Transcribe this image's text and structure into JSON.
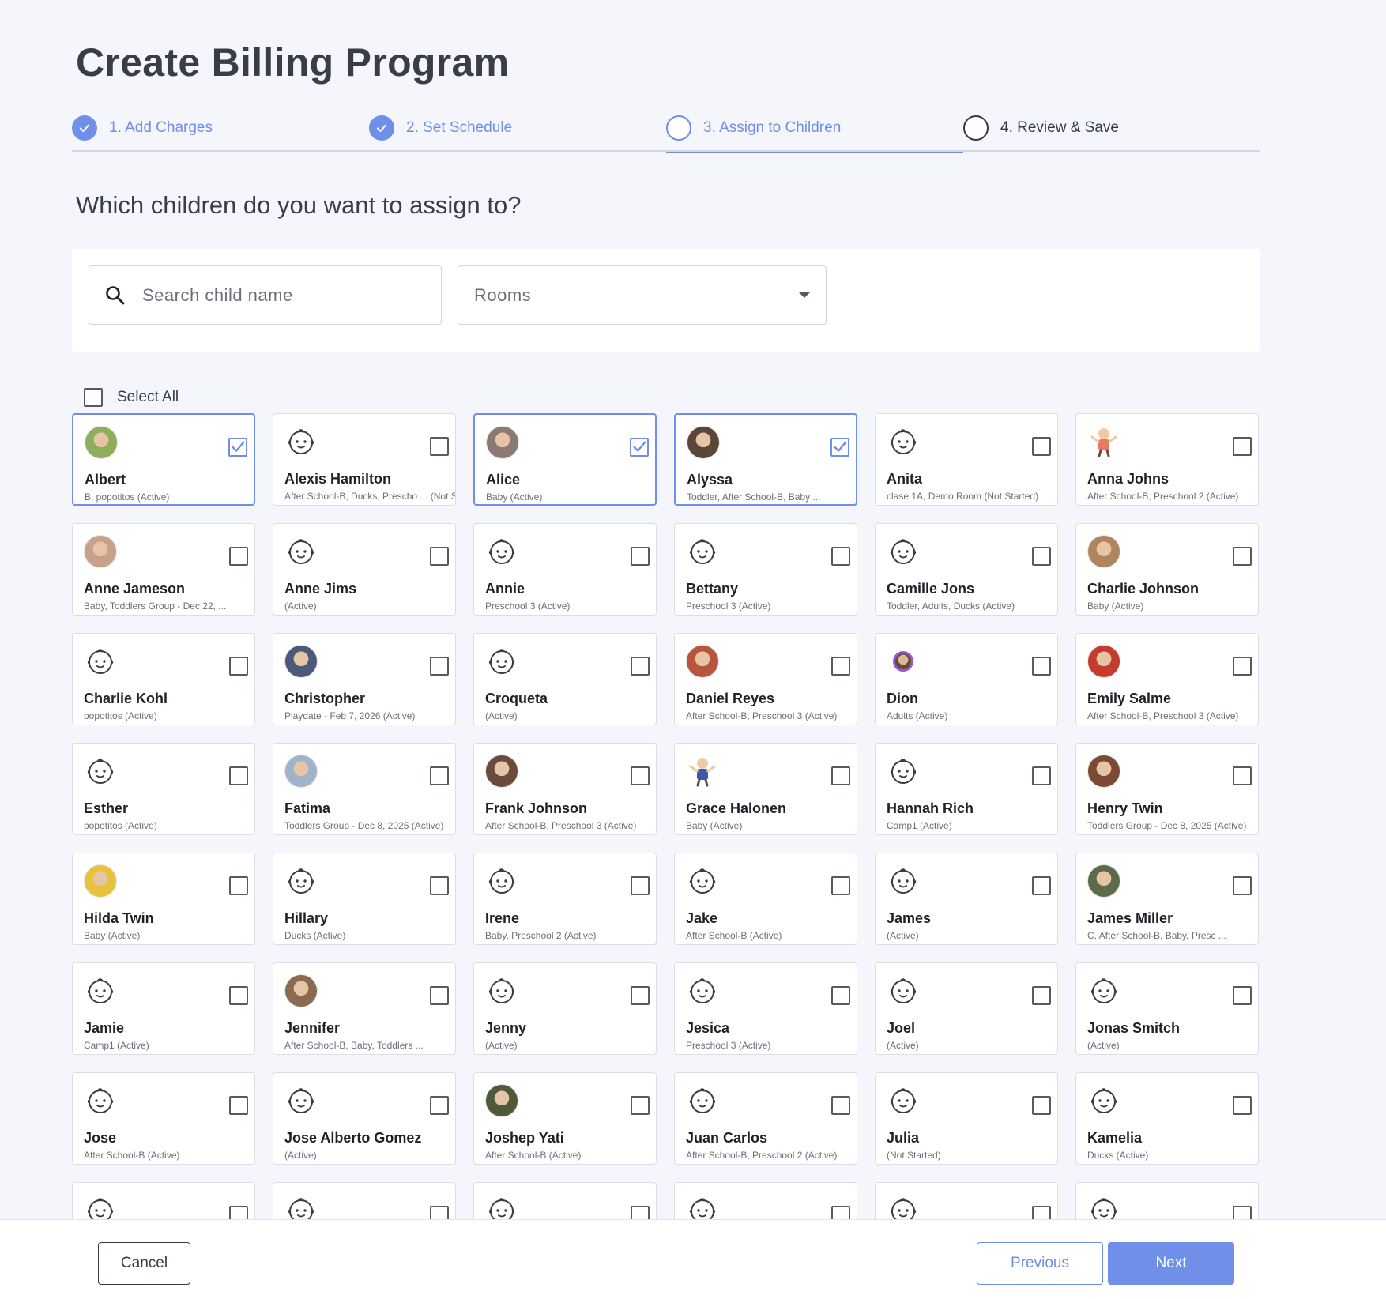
{
  "page": {
    "title": "Create Billing Program",
    "question": "Which children do you want to assign to?"
  },
  "steps": [
    {
      "label": "1. Add Charges",
      "state": "done"
    },
    {
      "label": "2. Set Schedule",
      "state": "done"
    },
    {
      "label": "3. Assign to Children",
      "state": "current"
    },
    {
      "label": "4. Review & Save",
      "state": "todo"
    }
  ],
  "filters": {
    "search_placeholder": "Search child name",
    "rooms_label": "Rooms"
  },
  "select_all": {
    "label": "Select All",
    "checked": false
  },
  "children": [
    {
      "name": "Albert",
      "sub": "B, popotitos (Active)",
      "avatar": "photo",
      "color": "#8fae5a",
      "checked": true
    },
    {
      "name": "Alexis Hamilton",
      "sub": "After School-B, Ducks, Prescho ... (Not Started)",
      "avatar": "baby-icon",
      "checked": false
    },
    {
      "name": "Alice",
      "sub": "Baby (Active)",
      "avatar": "photo",
      "color": "#8a7a72",
      "checked": true
    },
    {
      "name": "Alyssa",
      "sub": "Toddler, After School-B, Baby ...",
      "avatar": "photo",
      "color": "#5b4638",
      "checked": true
    },
    {
      "name": "Anita",
      "sub": "clase 1A, Demo Room (Not Started)",
      "avatar": "baby-icon",
      "checked": false
    },
    {
      "name": "Anna Johns",
      "sub": "After School-B, Preschool 2 (Active)",
      "avatar": "cartoon",
      "color": "#e87a5d",
      "checked": false
    },
    {
      "name": "Anne Jameson",
      "sub": "Baby, Toddlers Group - Dec 22, ...",
      "avatar": "photo",
      "color": "#c9a089",
      "checked": false
    },
    {
      "name": "Anne Jims",
      "sub": "(Active)",
      "avatar": "baby-icon",
      "checked": false
    },
    {
      "name": "Annie",
      "sub": "Preschool 3 (Active)",
      "avatar": "baby-icon",
      "checked": false
    },
    {
      "name": "Bettany",
      "sub": "Preschool 3 (Active)",
      "avatar": "baby-icon",
      "checked": false
    },
    {
      "name": "Camille Jons",
      "sub": "Toddler, Adults, Ducks (Active)",
      "avatar": "baby-icon",
      "checked": false
    },
    {
      "name": "Charlie Johnson",
      "sub": "Baby (Active)",
      "avatar": "photo",
      "color": "#b0845e",
      "checked": false
    },
    {
      "name": "Charlie Kohl",
      "sub": "popotitos (Active)",
      "avatar": "baby-icon",
      "checked": false
    },
    {
      "name": "Christopher",
      "sub": "Playdate - Feb 7, 2026 (Active)",
      "avatar": "photo",
      "color": "#4a5a78",
      "checked": false
    },
    {
      "name": "Croqueta",
      "sub": "(Active)",
      "avatar": "baby-icon",
      "checked": false
    },
    {
      "name": "Daniel Reyes",
      "sub": "After School-B, Preschool 3 (Active)",
      "avatar": "photo",
      "color": "#b8553f",
      "checked": false
    },
    {
      "name": "Dion",
      "sub": "Adults (Active)",
      "avatar": "small-photo",
      "color": "#9b59d0",
      "checked": false
    },
    {
      "name": "Emily Salme",
      "sub": "After School-B, Preschool 3 (Active)",
      "avatar": "photo",
      "color": "#c43c2e",
      "checked": false
    },
    {
      "name": "Esther",
      "sub": "popotitos (Active)",
      "avatar": "baby-icon",
      "checked": false
    },
    {
      "name": "Fatima",
      "sub": "Toddlers Group - Dec 8, 2025 (Active)",
      "avatar": "photo",
      "color": "#9fb4c8",
      "checked": false
    },
    {
      "name": "Frank Johnson",
      "sub": "After School-B, Preschool 3 (Active)",
      "avatar": "photo",
      "color": "#6a4a3c",
      "checked": false
    },
    {
      "name": "Grace Halonen",
      "sub": "Baby (Active)",
      "avatar": "cartoon",
      "color": "#3d5aa8",
      "checked": false
    },
    {
      "name": "Hannah Rich",
      "sub": "Camp1 (Active)",
      "avatar": "baby-icon",
      "checked": false
    },
    {
      "name": "Henry Twin",
      "sub": "Toddlers Group - Dec 8, 2025 (Active)",
      "avatar": "photo",
      "color": "#7a4a34",
      "checked": false
    },
    {
      "name": "Hilda Twin",
      "sub": "Baby (Active)",
      "avatar": "photo",
      "color": "#e8c23a",
      "checked": false
    },
    {
      "name": "Hillary",
      "sub": "Ducks (Active)",
      "avatar": "baby-icon",
      "checked": false
    },
    {
      "name": "Irene",
      "sub": "Baby, Preschool 2 (Active)",
      "avatar": "baby-icon",
      "checked": false
    },
    {
      "name": "Jake",
      "sub": "After School-B (Active)",
      "avatar": "baby-icon",
      "checked": false
    },
    {
      "name": "James",
      "sub": "(Active)",
      "avatar": "baby-icon",
      "checked": false
    },
    {
      "name": "James Miller",
      "sub": "C, After School-B, Baby, Presc ...",
      "avatar": "photo",
      "color": "#5e6b4a",
      "checked": false
    },
    {
      "name": "Jamie",
      "sub": "Camp1 (Active)",
      "avatar": "baby-icon",
      "checked": false
    },
    {
      "name": "Jennifer",
      "sub": "After School-B, Baby, Toddlers ...",
      "avatar": "photo",
      "color": "#8a6a50",
      "checked": false
    },
    {
      "name": "Jenny",
      "sub": "(Active)",
      "avatar": "baby-icon",
      "checked": false
    },
    {
      "name": "Jesica",
      "sub": "Preschool 3 (Active)",
      "avatar": "baby-icon",
      "checked": false
    },
    {
      "name": "Joel",
      "sub": "(Active)",
      "avatar": "baby-icon",
      "checked": false
    },
    {
      "name": "Jonas Smitch",
      "sub": "(Active)",
      "avatar": "baby-icon",
      "checked": false
    },
    {
      "name": "Jose",
      "sub": "After School-B (Active)",
      "avatar": "baby-icon",
      "checked": false
    },
    {
      "name": "Jose Alberto Gomez",
      "sub": "(Active)",
      "avatar": "baby-icon",
      "checked": false
    },
    {
      "name": "Joshep Yati",
      "sub": "After School-B (Active)",
      "avatar": "photo",
      "color": "#4e5a3a",
      "checked": false
    },
    {
      "name": "Juan Carlos",
      "sub": "After School-B, Preschool 2 (Active)",
      "avatar": "baby-icon",
      "checked": false
    },
    {
      "name": "Julia",
      "sub": "(Not Started)",
      "avatar": "baby-icon",
      "checked": false
    },
    {
      "name": "Kamelia",
      "sub": "Ducks (Active)",
      "avatar": "baby-icon",
      "checked": false
    },
    {
      "name": "",
      "sub": "",
      "avatar": "baby-icon",
      "checked": false
    },
    {
      "name": "",
      "sub": "",
      "avatar": "baby-icon",
      "checked": false
    },
    {
      "name": "",
      "sub": "",
      "avatar": "baby-icon",
      "checked": false
    },
    {
      "name": "",
      "sub": "",
      "avatar": "baby-icon",
      "checked": false
    },
    {
      "name": "",
      "sub": "",
      "avatar": "baby-icon",
      "checked": false
    },
    {
      "name": "",
      "sub": "",
      "avatar": "baby-icon",
      "checked": false
    }
  ],
  "footer": {
    "cancel_label": "Cancel",
    "previous_label": "Previous",
    "next_label": "Next"
  },
  "colors": {
    "accent": "#6f8fe8",
    "background": "#f5f6fb",
    "text": "#333a45"
  }
}
